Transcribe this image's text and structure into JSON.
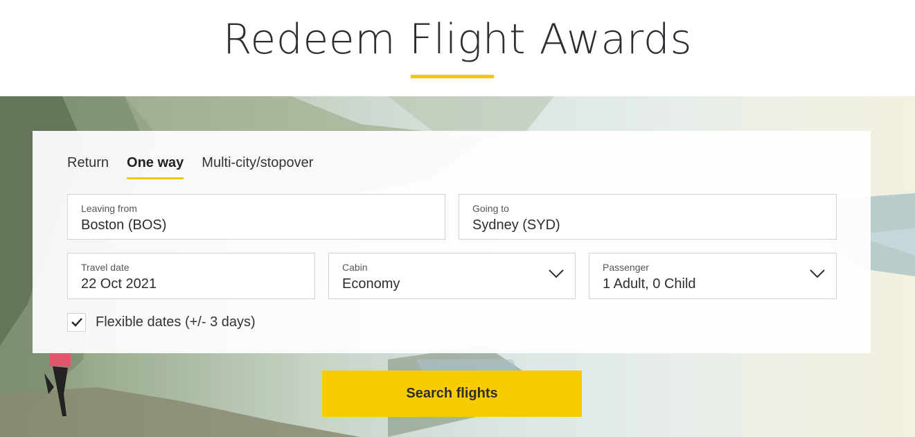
{
  "page": {
    "title": "Redeem Flight Awards",
    "accent_color": "#f5c800"
  },
  "trip_tabs": [
    {
      "label": "Return",
      "active": false
    },
    {
      "label": "One way",
      "active": true
    },
    {
      "label": "Multi-city/stopover",
      "active": false
    }
  ],
  "form": {
    "leaving_from": {
      "label": "Leaving from",
      "value": "Boston (BOS)"
    },
    "going_to": {
      "label": "Going to",
      "value": "Sydney (SYD)"
    },
    "travel_date": {
      "label": "Travel date",
      "value": "22 Oct 2021"
    },
    "cabin": {
      "label": "Cabin",
      "value": "Economy",
      "icon": "chevron-down-icon"
    },
    "passenger": {
      "label": "Passenger",
      "value": "1 Adult, 0 Child",
      "icon": "chevron-down-icon"
    },
    "flexible_dates": {
      "label": "Flexible dates (+/- 3 days)",
      "checked": true,
      "icon": "checkmark-icon"
    }
  },
  "search_button": {
    "label": "Search flights",
    "color": "#f9cc00"
  }
}
